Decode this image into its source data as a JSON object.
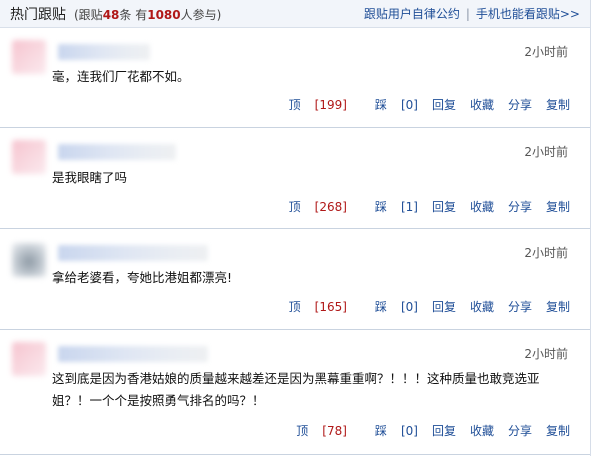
{
  "header": {
    "title": "热门跟贴",
    "stats_prefix": "(跟贴",
    "stats_posts": "48",
    "stats_mid": "条 有",
    "stats_people": "1080",
    "stats_suffix": "人参与)",
    "link_rules": "跟贴用户自律公约",
    "link_mobile": "手机也能看跟贴>>"
  },
  "labels": {
    "up": "顶",
    "down": "踩",
    "reply": "回复",
    "favorite": "收藏",
    "share": "分享",
    "copy": "复制"
  },
  "comments": [
    {
      "time": "2小时前",
      "text": "毫，连我们厂花都不如。",
      "up": "[199]",
      "down": "[0]"
    },
    {
      "time": "2小时前",
      "text": "是我眼瞎了吗",
      "up": "[268]",
      "down": "[1]"
    },
    {
      "time": "2小时前",
      "text": "拿给老婆看，夸她比港姐都漂亮!",
      "up": "[165]",
      "down": "[0]"
    },
    {
      "time": "2小时前",
      "text": "这到底是因为香港姑娘的质量越来越差还是因为黑幕重重啊？！！！这种质量也敢竞选亚姐？！一个个是按照勇气排名的吗？！",
      "up": "[78]",
      "down": "[0]"
    }
  ],
  "colors": {
    "link": "#1f4e97",
    "count": "#b01818",
    "header_bg": "#f2f5fa"
  }
}
